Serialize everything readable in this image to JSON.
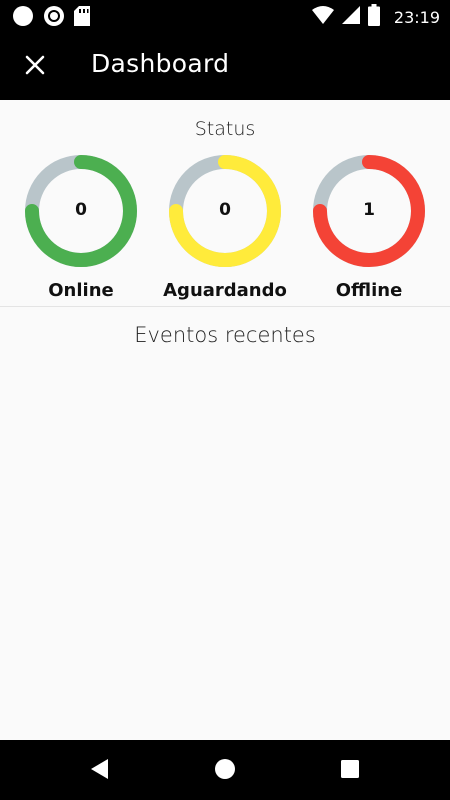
{
  "status_bar": {
    "time": "23:19",
    "icons": [
      "circle-icon",
      "sync-icon",
      "sd-card-icon",
      "wifi-icon",
      "signal-icon",
      "battery-icon"
    ]
  },
  "app_bar": {
    "title": "Dashboard",
    "close_icon": "close-icon"
  },
  "status": {
    "title": "Status",
    "gauges": [
      {
        "label": "Online",
        "value": "0",
        "color": "#4caf50",
        "track_color": "#b9c5ca"
      },
      {
        "label": "Aguardando",
        "value": "0",
        "color": "#ffeb3b",
        "track_color": "#b9c5ca"
      },
      {
        "label": "Offline",
        "value": "1",
        "color": "#f44336",
        "track_color": "#b9c5ca"
      }
    ]
  },
  "events": {
    "title": "Eventos recentes"
  },
  "nav_bar": {
    "icons": [
      "back-icon",
      "home-icon",
      "recents-icon"
    ]
  }
}
